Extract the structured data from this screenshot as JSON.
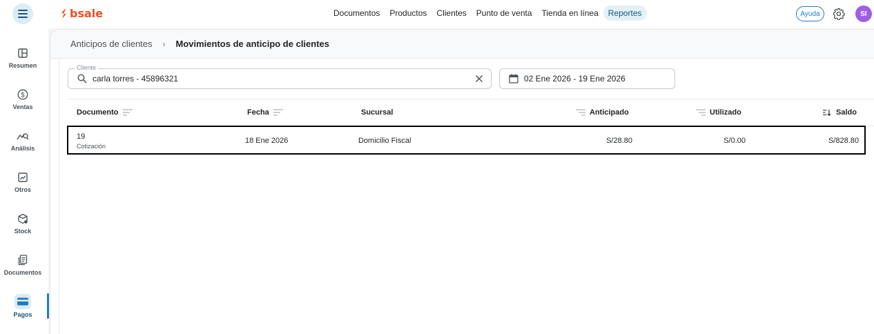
{
  "app": {
    "brand": "bsale",
    "brand_color": "#f04e23",
    "accent_color": "#1e7bbf"
  },
  "topnav": {
    "items": [
      "Documentos",
      "Productos",
      "Clientes",
      "Punto de venta",
      "Tienda en línea",
      "Reportes"
    ],
    "active": "Reportes",
    "help_label": "Ayuda",
    "avatar_initials": "SI"
  },
  "sidebar": {
    "items": [
      {
        "label": "Resumen",
        "icon": "dashboard-icon"
      },
      {
        "label": "Ventas",
        "icon": "dollar-circle-icon"
      },
      {
        "label": "Análisis",
        "icon": "chart-search-icon"
      },
      {
        "label": "Otros",
        "icon": "trend-box-icon"
      },
      {
        "label": "Stock",
        "icon": "box-icon"
      },
      {
        "label": "Documentos",
        "icon": "documents-icon"
      },
      {
        "label": "Pagos",
        "icon": "card-icon"
      }
    ],
    "active": "Pagos"
  },
  "breadcrumb": {
    "parent": "Anticipos de clientes",
    "separator": "›",
    "current": "Movimientos de anticipo de clientes"
  },
  "filters": {
    "client_label": "Cliente",
    "client_value": "carla torres - 45896321",
    "date_range": "02 Ene 2026 - 19 Ene 2026"
  },
  "table": {
    "columns": [
      "Documento",
      "Fecha",
      "Sucursal",
      "Anticipado",
      "Utilizado",
      "Saldo"
    ],
    "rows": [
      {
        "documento": "19",
        "tipo": "Cotización",
        "fecha": "18 Ene 2026",
        "sucursal": "Domicilio Fiscal",
        "anticipado": "S/28.80",
        "utilizado": "S/0.00",
        "saldo": "S/828.80"
      }
    ]
  }
}
